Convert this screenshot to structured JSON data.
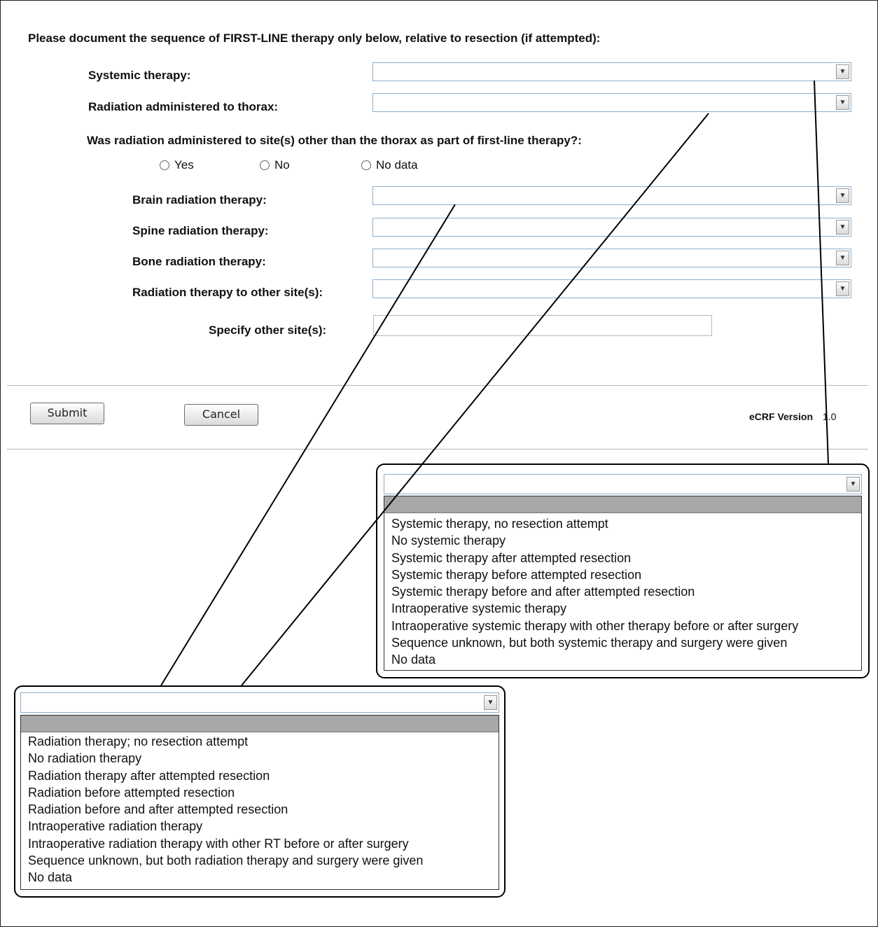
{
  "heading": "Please document the sequence of FIRST-LINE therapy only below, relative to resection (if attempted):",
  "fields": {
    "systemic": "Systemic therapy:",
    "thorax": "Radiation administered to thorax:",
    "other_question": "Was radiation administered to site(s) other than the thorax as part of first-line therapy?:",
    "brain": "Brain radiation therapy:",
    "spine": "Spine radiation therapy:",
    "bone": "Bone radiation therapy:",
    "other_site": "Radiation therapy to other site(s):",
    "specify": "Specify other site(s):"
  },
  "radio": {
    "yes": "Yes",
    "no": "No",
    "nodata": "No data"
  },
  "buttons": {
    "submit": "Submit",
    "cancel": "Cancel"
  },
  "version": {
    "label": "eCRF Version",
    "value": "1.0"
  },
  "systemic_options": [
    "Systemic therapy, no resection attempt",
    "No systemic therapy",
    "Systemic therapy after attempted resection",
    "Systemic therapy before attempted resection",
    "Systemic therapy before and after attempted resection",
    "Intraoperative systemic therapy",
    "Intraoperative systemic therapy with other therapy before or after surgery",
    "Sequence unknown, but both systemic therapy and surgery were given",
    "No data"
  ],
  "radiation_options": [
    "Radiation therapy; no resection attempt",
    "No radiation therapy",
    "Radiation therapy after attempted resection",
    "Radiation before attempted resection",
    "Radiation before and after attempted resection",
    "Intraoperative radiation therapy",
    "Intraoperative radiation therapy with other RT before or after surgery",
    "Sequence unknown, but both radiation therapy and surgery were given",
    "No data"
  ],
  "icons": {
    "dropdown": "chevron-down-icon",
    "radio": "radio-unselected-icon"
  }
}
